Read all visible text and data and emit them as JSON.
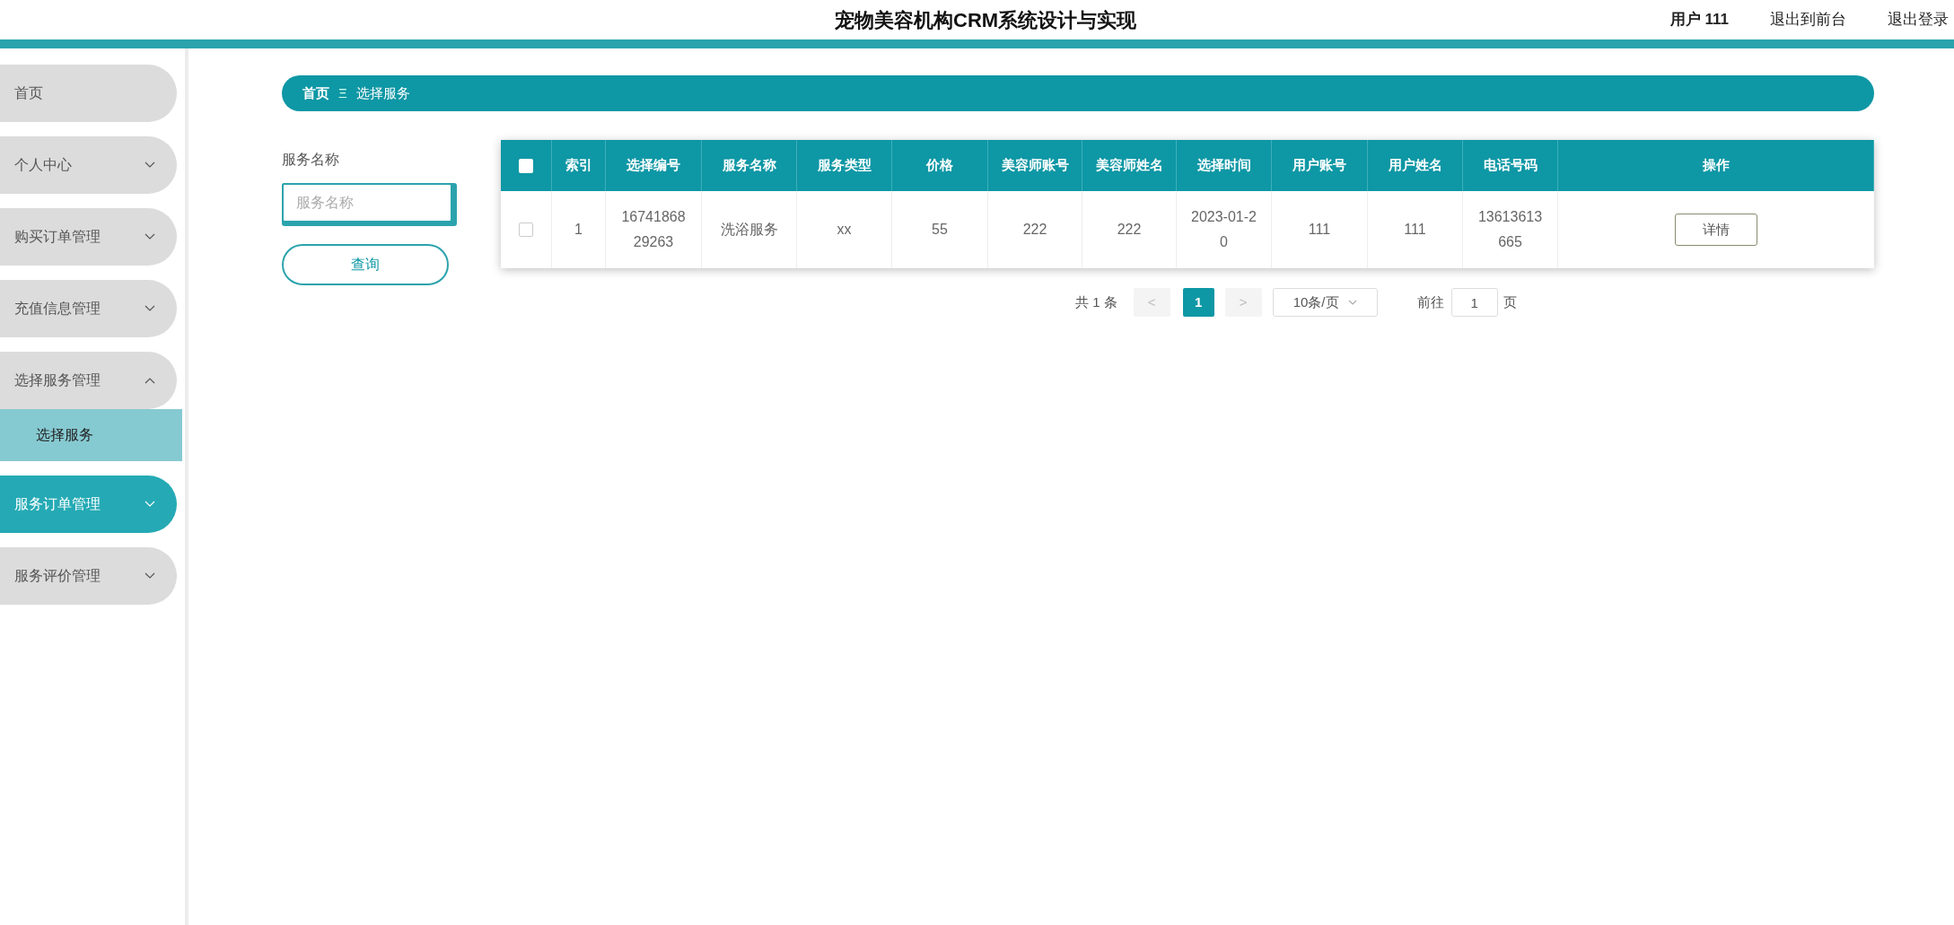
{
  "header": {
    "title": "宠物美容机构CRM系统设计与实现",
    "user": "用户 111",
    "links": [
      "退出到前台",
      "退出登录"
    ]
  },
  "sidebar": {
    "items": [
      {
        "label": "首页",
        "has_arrow": false,
        "selected": false
      },
      {
        "label": "个人中心",
        "has_arrow": true,
        "expanded": false,
        "selected": false
      },
      {
        "label": "购买订单管理",
        "has_arrow": true,
        "expanded": false,
        "selected": false
      },
      {
        "label": "充值信息管理",
        "has_arrow": true,
        "expanded": false,
        "selected": false
      },
      {
        "label": "选择服务管理",
        "has_arrow": true,
        "expanded": true,
        "selected": false,
        "children": [
          {
            "label": "选择服务",
            "selected": true
          }
        ]
      },
      {
        "label": "服务订单管理",
        "has_arrow": true,
        "expanded": false,
        "selected": true
      },
      {
        "label": "服务评价管理",
        "has_arrow": true,
        "expanded": false,
        "selected": false
      }
    ]
  },
  "breadcrumb": {
    "items": [
      "首页",
      "选择服务"
    ],
    "separator": "Ξ"
  },
  "search": {
    "label": "服务名称",
    "placeholder": "服务名称",
    "button": "查询"
  },
  "table": {
    "all_checked": false,
    "columns": [
      "索引",
      "选择编号",
      "服务名称",
      "服务类型",
      "价格",
      "美容师账号",
      "美容师姓名",
      "选择时间",
      "用户账号",
      "用户姓名",
      "电话号码",
      "操作"
    ],
    "rows": [
      {
        "checked": false,
        "cells": [
          "1",
          "1674186829263",
          "洗浴服务",
          "xx",
          "55",
          "222",
          "222",
          "2023-01-20",
          "111",
          "111",
          "13613613665"
        ],
        "action": "详情"
      }
    ]
  },
  "pagination": {
    "total": "共 1 条",
    "prev": "<",
    "pages": [
      {
        "label": "1",
        "selected": true
      }
    ],
    "next": ">",
    "page_size": "10条/页",
    "goto_label": "前往",
    "goto_value": "1",
    "goto_suffix": "页"
  }
}
